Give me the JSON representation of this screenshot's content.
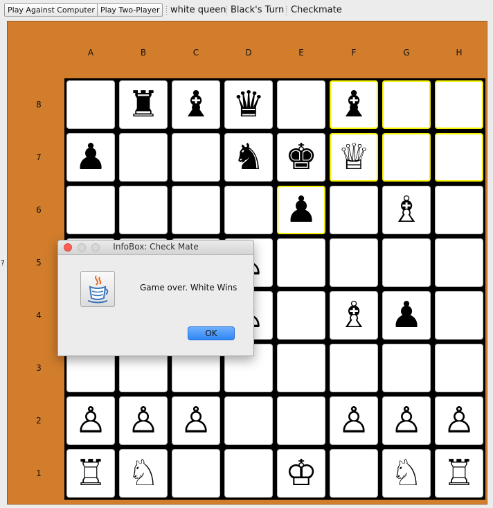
{
  "toolbar": {
    "play_computer": "Play Against Computer",
    "play_two_player": "Play Two-Player",
    "selected_piece": "white queen",
    "turn": "Black's Turn",
    "status": "Checkmate"
  },
  "side_marker": "?",
  "board": {
    "files": [
      "A",
      "B",
      "C",
      "D",
      "E",
      "F",
      "G",
      "H"
    ],
    "ranks": [
      "8",
      "7",
      "6",
      "5",
      "4",
      "3",
      "2",
      "1"
    ],
    "rows": [
      [
        "",
        "black-rook",
        "black-bishop",
        "black-queen",
        "",
        "black-bishop",
        "",
        ""
      ],
      [
        "black-pawn",
        "",
        "",
        "black-knight",
        "black-king",
        "white-queen",
        "",
        ""
      ],
      [
        "",
        "",
        "",
        "",
        "black-pawn",
        "",
        "white-bishop",
        ""
      ],
      [
        "",
        "",
        "",
        "white-pawn",
        "",
        "",
        "",
        ""
      ],
      [
        "",
        "",
        "",
        "white-pawn",
        "",
        "white-bishop",
        "black-pawn",
        ""
      ],
      [
        "",
        "",
        "",
        "",
        "",
        "",
        "",
        ""
      ],
      [
        "white-pawn",
        "white-pawn",
        "white-pawn",
        "",
        "",
        "white-pawn",
        "white-pawn",
        "white-pawn"
      ],
      [
        "white-rook",
        "white-knight",
        "",
        "",
        "white-king",
        "",
        "white-knight",
        "white-rook"
      ]
    ],
    "highlighted": [
      "F8",
      "G8",
      "H8",
      "F7",
      "G7",
      "H7",
      "E6"
    ],
    "colors": {
      "frame": "#d17d2c",
      "square": "#ffffff",
      "grid": "#000000",
      "highlight": "#f5f000"
    }
  },
  "dialog": {
    "title": "InfoBox: Check Mate",
    "message": "Game over. White Wins",
    "ok_label": "OK",
    "icon": "java-icon"
  }
}
